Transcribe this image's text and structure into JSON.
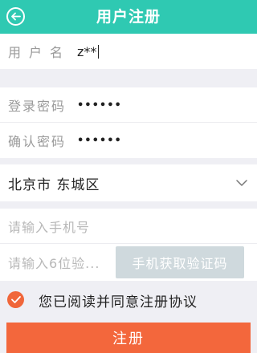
{
  "header": {
    "title": "用户注册",
    "back_icon": "back-arrow-icon",
    "color": "#2fc9b2"
  },
  "form": {
    "username": {
      "label": "用户名",
      "value": "z**"
    },
    "password": {
      "label": "登录密码",
      "value": "••••••"
    },
    "confirm": {
      "label": "确认密码",
      "value": "••••••"
    },
    "region": {
      "value": "北京市 东城区",
      "icon": "chevron-down-icon"
    },
    "phone": {
      "placeholder": "请输入手机号"
    },
    "code": {
      "placeholder": "请输入6位验...",
      "button": "手机获取验证码"
    }
  },
  "agreement": {
    "text": "您已阅读并同意注册协议",
    "checked": true,
    "icon": "check-icon"
  },
  "submit": {
    "label": "注册",
    "color": "#f3673c"
  }
}
